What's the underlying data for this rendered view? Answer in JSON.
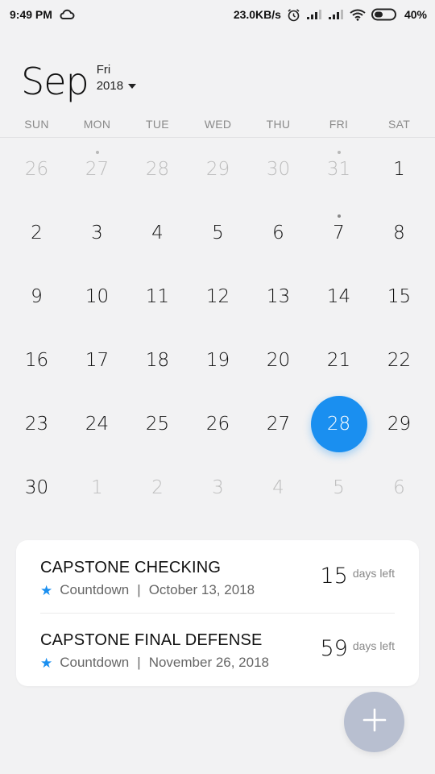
{
  "status_bar": {
    "time": "9:49 PM",
    "speed": "23.0KB/s",
    "battery": "40%",
    "icons": [
      "cloud-icon",
      "alarm-icon",
      "signal-icon",
      "signal-icon",
      "wifi-icon",
      "battery-icon"
    ]
  },
  "header": {
    "month": "Sep",
    "weekday": "Fri",
    "year": "2018"
  },
  "weekdays": [
    "SUN",
    "MON",
    "TUE",
    "WED",
    "THU",
    "FRI",
    "SAT"
  ],
  "calendar": {
    "selected_day": "28",
    "accent_color": "#1a8ff0",
    "days": [
      {
        "d": "26",
        "out": true,
        "dot": false
      },
      {
        "d": "27",
        "out": true,
        "dot": true
      },
      {
        "d": "28",
        "out": true,
        "dot": false
      },
      {
        "d": "29",
        "out": true,
        "dot": false
      },
      {
        "d": "30",
        "out": true,
        "dot": false
      },
      {
        "d": "31",
        "out": true,
        "dot": true
      },
      {
        "d": "1",
        "out": false,
        "dot": false
      },
      {
        "d": "2",
        "out": false,
        "dot": false
      },
      {
        "d": "3",
        "out": false,
        "dot": false
      },
      {
        "d": "4",
        "out": false,
        "dot": false
      },
      {
        "d": "5",
        "out": false,
        "dot": false
      },
      {
        "d": "6",
        "out": false,
        "dot": false
      },
      {
        "d": "7",
        "out": false,
        "dot": true
      },
      {
        "d": "8",
        "out": false,
        "dot": false
      },
      {
        "d": "9",
        "out": false,
        "dot": false
      },
      {
        "d": "10",
        "out": false,
        "dot": false
      },
      {
        "d": "11",
        "out": false,
        "dot": false
      },
      {
        "d": "12",
        "out": false,
        "dot": false
      },
      {
        "d": "13",
        "out": false,
        "dot": false
      },
      {
        "d": "14",
        "out": false,
        "dot": false
      },
      {
        "d": "15",
        "out": false,
        "dot": false
      },
      {
        "d": "16",
        "out": false,
        "dot": false
      },
      {
        "d": "17",
        "out": false,
        "dot": false
      },
      {
        "d": "18",
        "out": false,
        "dot": false
      },
      {
        "d": "19",
        "out": false,
        "dot": false
      },
      {
        "d": "20",
        "out": false,
        "dot": false
      },
      {
        "d": "21",
        "out": false,
        "dot": false
      },
      {
        "d": "22",
        "out": false,
        "dot": false
      },
      {
        "d": "23",
        "out": false,
        "dot": false
      },
      {
        "d": "24",
        "out": false,
        "dot": false
      },
      {
        "d": "25",
        "out": false,
        "dot": false
      },
      {
        "d": "26",
        "out": false,
        "dot": false
      },
      {
        "d": "27",
        "out": false,
        "dot": false
      },
      {
        "d": "28",
        "out": false,
        "dot": false,
        "selected": true
      },
      {
        "d": "29",
        "out": false,
        "dot": false
      },
      {
        "d": "30",
        "out": false,
        "dot": false
      },
      {
        "d": "1",
        "out": true,
        "dot": false
      },
      {
        "d": "2",
        "out": true,
        "dot": false
      },
      {
        "d": "3",
        "out": true,
        "dot": false
      },
      {
        "d": "4",
        "out": true,
        "dot": false
      },
      {
        "d": "5",
        "out": true,
        "dot": false
      },
      {
        "d": "6",
        "out": true,
        "dot": false
      }
    ]
  },
  "events": [
    {
      "title": "CAPSTONE CHECKING",
      "type": "Countdown",
      "date": "October 13, 2018",
      "days": "15",
      "days_label": "days left",
      "icon": "star-icon"
    },
    {
      "title": "CAPSTONE FINAL DEFENSE",
      "type": "Countdown",
      "date": "November 26, 2018",
      "days": "59",
      "days_label": "days left",
      "icon": "star-icon"
    }
  ],
  "fab": {
    "icon": "plus-icon"
  }
}
